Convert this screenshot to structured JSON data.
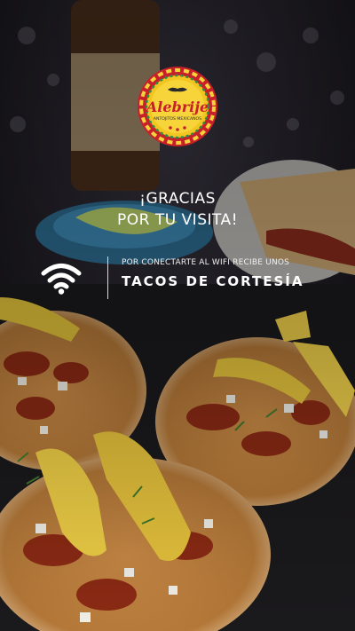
{
  "logo": {
    "brand": "Alebrije",
    "tagline": "ANTOJITOS MEXICANOS"
  },
  "message": {
    "line1": "¡GRACIAS",
    "line2": "POR TU VISITA!"
  },
  "offer": {
    "small": "POR CONECTARTE AL WIFI RECIBE UNOS",
    "big": "TACOS DE CORTESÍA"
  },
  "icons": {
    "wifi": "wifi-icon"
  }
}
